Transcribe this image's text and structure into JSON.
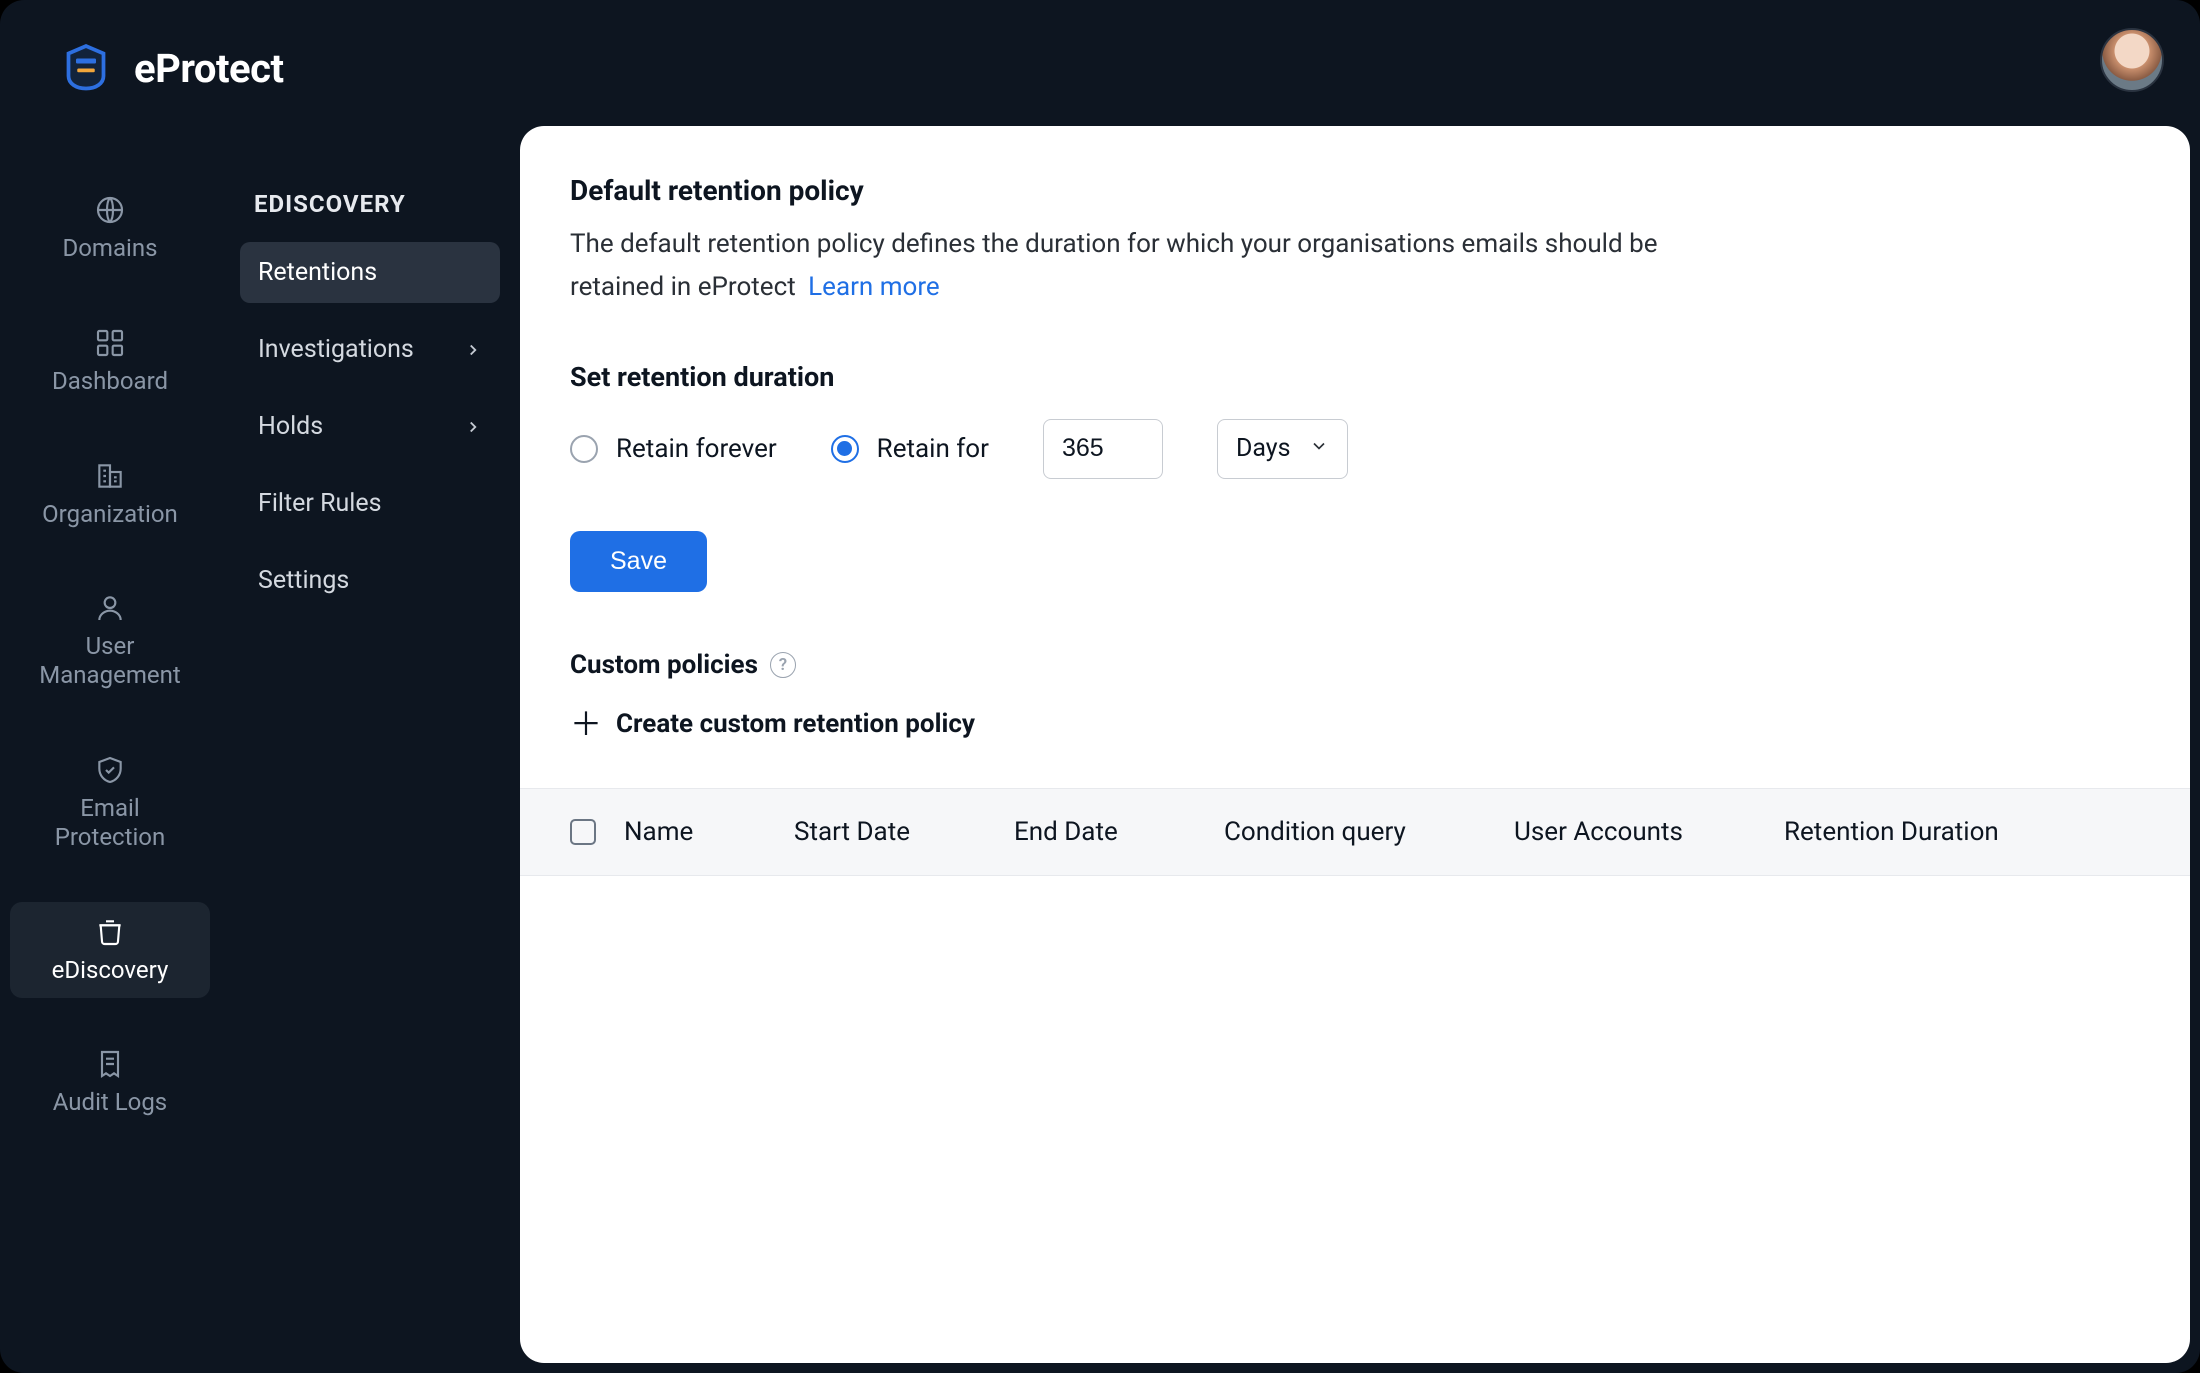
{
  "brand": {
    "name": "eProtect"
  },
  "primaryNav": {
    "items": [
      {
        "label": "Domains"
      },
      {
        "label": "Dashboard"
      },
      {
        "label": "Organization"
      },
      {
        "label": "User\nManagement"
      },
      {
        "label": "Email\nProtection"
      },
      {
        "label": "eDiscovery"
      },
      {
        "label": "Audit Logs"
      }
    ],
    "activeIndex": 5
  },
  "secondaryNav": {
    "heading": "EDISCOVERY",
    "items": [
      {
        "label": "Retentions",
        "hasChildren": false
      },
      {
        "label": "Investigations",
        "hasChildren": true
      },
      {
        "label": "Holds",
        "hasChildren": true
      },
      {
        "label": "Filter Rules",
        "hasChildren": false
      },
      {
        "label": "Settings",
        "hasChildren": false
      }
    ],
    "activeIndex": 0
  },
  "retention": {
    "title": "Default retention policy",
    "description": "The default retention policy defines the duration for which your organisations emails should be retained in eProtect",
    "learnMore": "Learn more",
    "durationTitle": "Set retention duration",
    "options": {
      "forever": "Retain forever",
      "for": "Retain for"
    },
    "selected": "for",
    "value": "365",
    "unit": "Days",
    "saveLabel": "Save"
  },
  "custom": {
    "title": "Custom policies",
    "createLabel": "Create custom retention policy"
  },
  "table": {
    "columns": {
      "name": "Name",
      "start": "Start Date",
      "end": "End Date",
      "condition": "Condition query",
      "accounts": "User Accounts",
      "retention": "Retention Duration"
    }
  }
}
